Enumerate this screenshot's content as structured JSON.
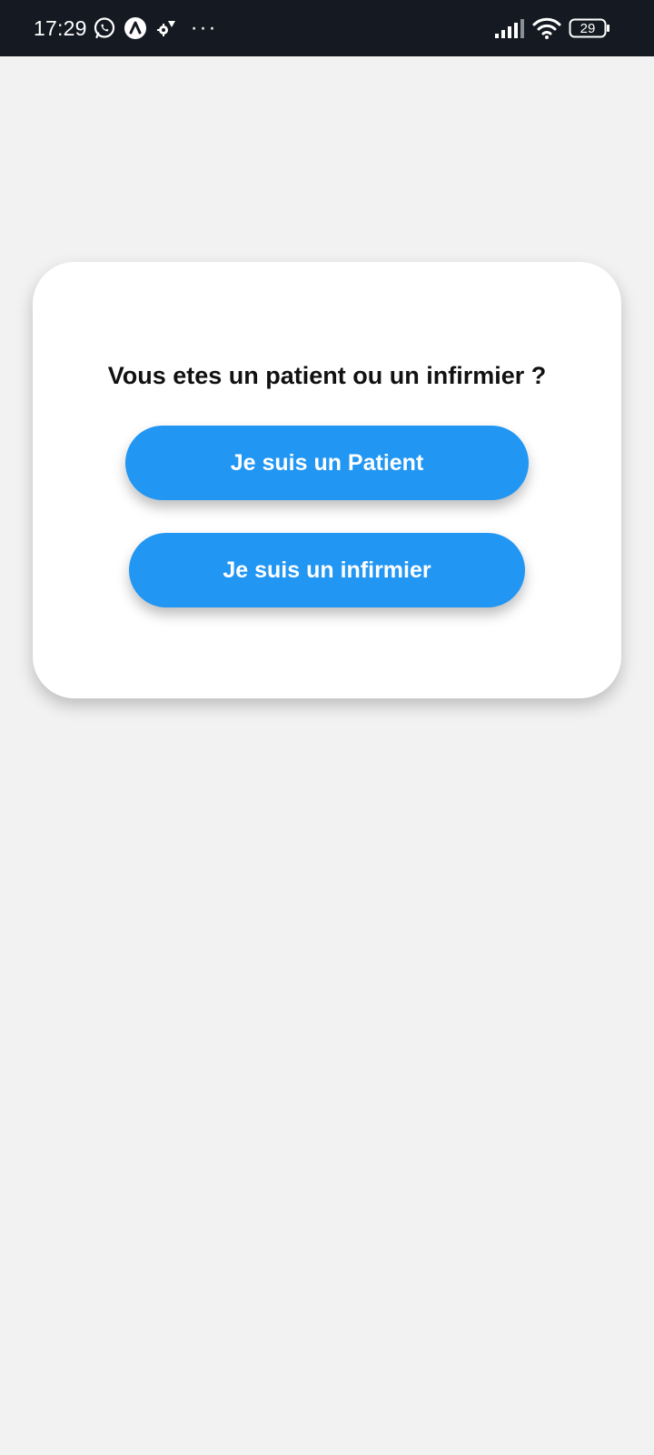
{
  "status_bar": {
    "time": "17:29",
    "battery": "29",
    "more_dots": "···",
    "left_icons": [
      "whatsapp-icon",
      "a-app-icon",
      "settings-gear-icon"
    ],
    "right_icons": [
      "signal-icon",
      "wifi-icon",
      "battery-icon"
    ]
  },
  "card": {
    "question": "Vous etes un patient ou un infirmier ?",
    "patient_button": "Je suis un Patient",
    "nurse_button": "Je suis un infirmier"
  },
  "colors": {
    "status_bar_bg": "#151a22",
    "page_bg": "#f2f2f2",
    "card_bg": "#ffffff",
    "button_bg": "#2196f3",
    "button_text": "#ffffff"
  }
}
